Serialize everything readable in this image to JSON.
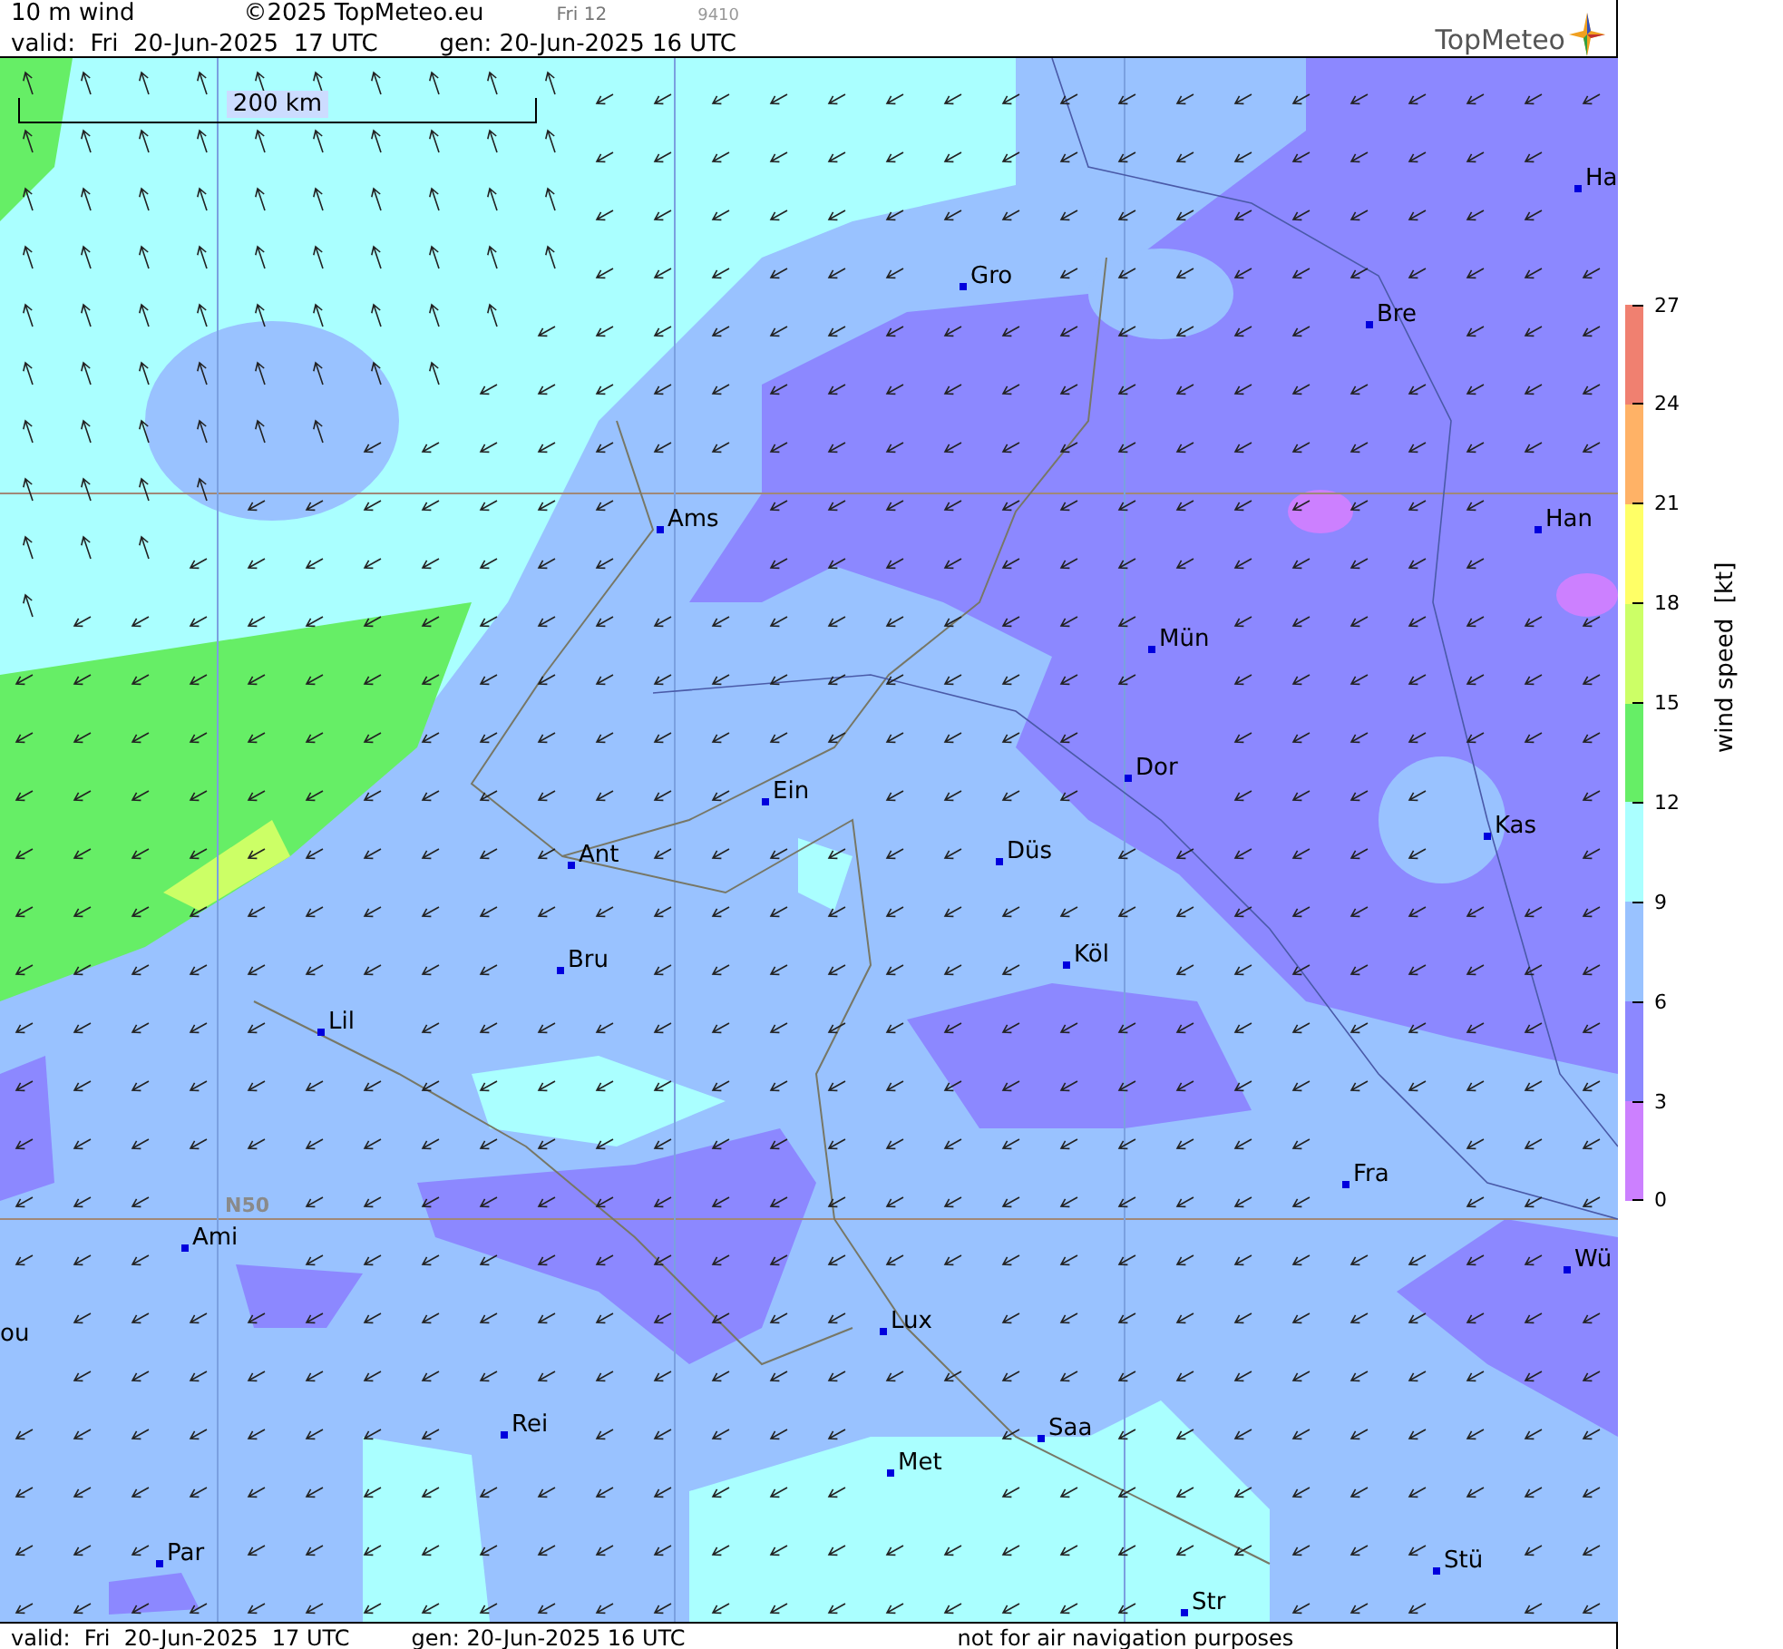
{
  "header": {
    "product": "10 m wind",
    "copyright": "©2025 TopMeteo.eu",
    "run": "Fri 12",
    "code": "9410",
    "valid": "valid:  Fri  20-Jun-2025  17 UTC",
    "generated": "gen: 20-Jun-2025 16 UTC",
    "logo": "TopMeteo"
  },
  "map": {
    "scale": "200 km",
    "latitude_label": "N50",
    "cities": [
      {
        "name": "Gro"
      },
      {
        "name": "Bre"
      },
      {
        "name": "Ha"
      },
      {
        "name": "Ams"
      },
      {
        "name": "Han"
      },
      {
        "name": "Mün"
      },
      {
        "name": "Dor"
      },
      {
        "name": "Ein"
      },
      {
        "name": "Kas"
      },
      {
        "name": "Ant"
      },
      {
        "name": "Düs"
      },
      {
        "name": "Bru"
      },
      {
        "name": "Köl"
      },
      {
        "name": "Lil"
      },
      {
        "name": "Fra"
      },
      {
        "name": "Ami"
      },
      {
        "name": "Wü"
      },
      {
        "name": "ou"
      },
      {
        "name": "Lux"
      },
      {
        "name": "Rei"
      },
      {
        "name": "Saa"
      },
      {
        "name": "Met"
      },
      {
        "name": "Par"
      },
      {
        "name": "Stü"
      },
      {
        "name": "Str"
      }
    ]
  },
  "legend": {
    "title": "wind speed  [kt]",
    "ticks": [
      "27",
      "24",
      "21",
      "18",
      "15",
      "12",
      "9",
      "6",
      "3",
      "0"
    ],
    "bands": [
      {
        "color": "#f08070"
      },
      {
        "color": "#ffb266"
      },
      {
        "color": "#ffff66"
      },
      {
        "color": "#ccff66"
      },
      {
        "color": "#66ee66"
      },
      {
        "color": "#aaffff"
      },
      {
        "color": "#99c2ff"
      },
      {
        "color": "#8c88ff"
      },
      {
        "color": "#cc80ff"
      }
    ]
  },
  "footer": {
    "valid": "valid:  Fri  20-Jun-2025  17 UTC",
    "generated": "gen: 20-Jun-2025 16 UTC",
    "notice": "not for air navigation purposes"
  }
}
